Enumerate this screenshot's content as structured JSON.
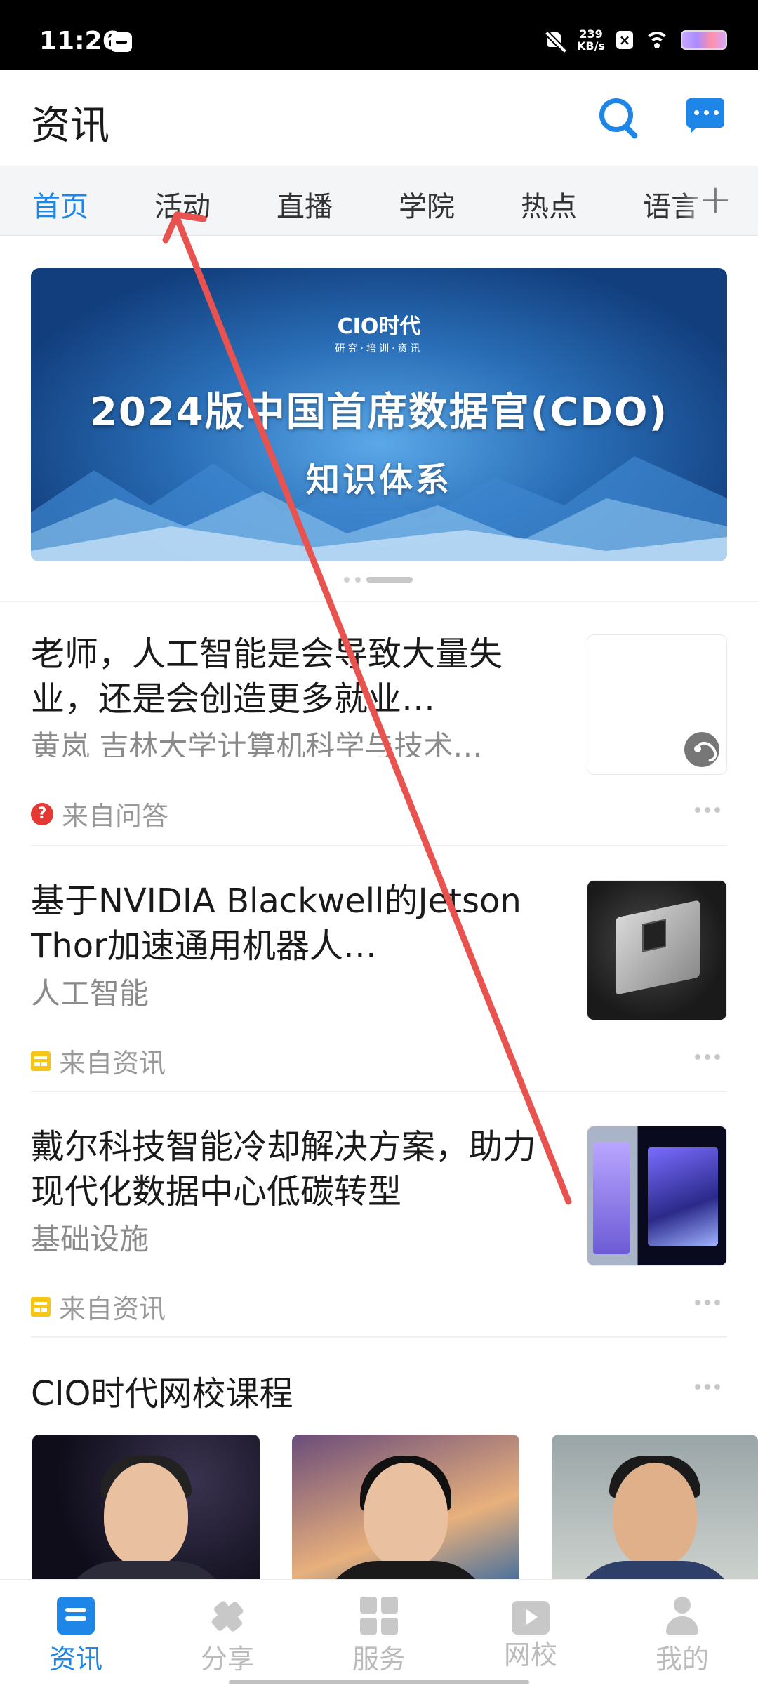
{
  "status_bar": {
    "time": "11:26",
    "net_speed_value": "239",
    "net_speed_unit": "KB/s"
  },
  "header": {
    "title": "资讯"
  },
  "tabs": [
    {
      "label": "首页",
      "active": true
    },
    {
      "label": "活动",
      "active": false
    },
    {
      "label": "直播",
      "active": false
    },
    {
      "label": "学院",
      "active": false
    },
    {
      "label": "热点",
      "active": false
    },
    {
      "label": "语言",
      "active": false
    }
  ],
  "banner": {
    "logo_text": "CIO时代",
    "logo_tagline": "研究·培训·资讯",
    "headline": "2024版中国首席数据官(CDO)",
    "subheadline": "知识体系"
  },
  "feed": [
    {
      "title": "老师，人工智能是会导致大量失业，还是会创造更多就业…",
      "subtitle": "黄岚 吉林大学计算机科学与技术…",
      "source": "来自问答",
      "source_icon": "question-icon"
    },
    {
      "title": "基于NVIDIA Blackwell的Jetson Thor加速通用机器人…",
      "subtitle": "人工智能",
      "source": "来自资讯",
      "source_icon": "news-icon"
    },
    {
      "title": "戴尔科技智能冷却解决方案，助力现代化数据中心低碳转型",
      "subtitle": "基础设施",
      "source": "来自资讯",
      "source_icon": "news-icon"
    }
  ],
  "courses": {
    "title": "CIO时代网校课程"
  },
  "bottom_nav": [
    {
      "label": "资讯",
      "icon": "news-icon",
      "active": true
    },
    {
      "label": "分享",
      "icon": "share-icon",
      "active": false
    },
    {
      "label": "服务",
      "icon": "services-icon",
      "active": false
    },
    {
      "label": "网校",
      "icon": "tv-icon",
      "active": false
    },
    {
      "label": "我的",
      "icon": "profile-icon",
      "active": false
    }
  ],
  "colors": {
    "accent": "#1e86e6",
    "annotation_arrow": "#e8524f",
    "question_badge": "#e53935",
    "news_badge": "#f5c518"
  }
}
